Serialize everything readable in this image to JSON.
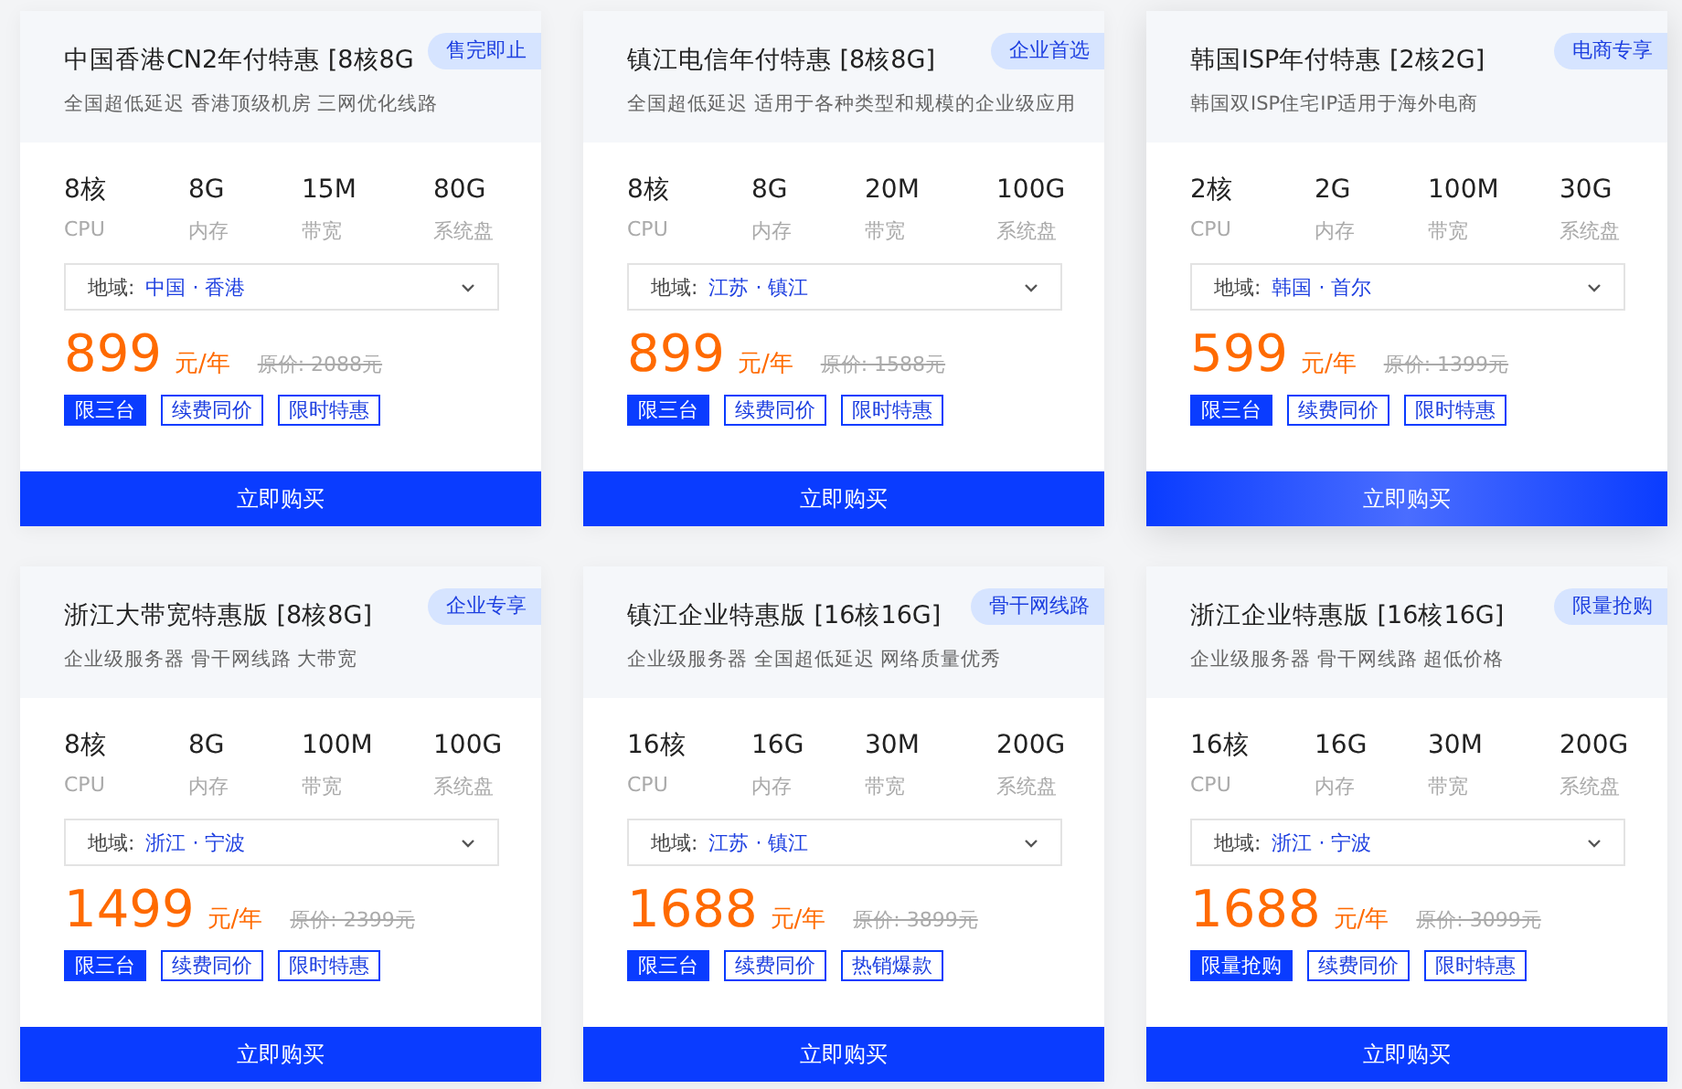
{
  "cards": [
    {
      "title": "中国香港CN2年付特惠 [8核8G",
      "badge": "售完即止",
      "subtitle": "全国超低延迟 香港顶级机房 三网优化线路",
      "specs": [
        {
          "value": "8核",
          "label": "CPU"
        },
        {
          "value": "8G",
          "label": "内存"
        },
        {
          "value": "15M",
          "label": "带宽"
        },
        {
          "value": "80G",
          "label": "系统盘"
        }
      ],
      "region_label": "地域:",
      "region": "中国 · 香港",
      "price": "899",
      "unit": "元/年",
      "original_price": "原价: 2088元",
      "tags": [
        {
          "text": "限三台",
          "filled": true
        },
        {
          "text": "续费同价",
          "filled": false
        },
        {
          "text": "限时特惠",
          "filled": false
        }
      ],
      "button": "立即购买",
      "hovered": false
    },
    {
      "title": "镇江电信年付特惠 [8核8G]",
      "badge": "企业首选",
      "subtitle": "全国超低延迟 适用于各种类型和规模的企业级应用",
      "specs": [
        {
          "value": "8核",
          "label": "CPU"
        },
        {
          "value": "8G",
          "label": "内存"
        },
        {
          "value": "20M",
          "label": "带宽"
        },
        {
          "value": "100G",
          "label": "系统盘"
        }
      ],
      "region_label": "地域:",
      "region": "江苏 · 镇江",
      "price": "899",
      "unit": "元/年",
      "original_price": "原价: 1588元",
      "tags": [
        {
          "text": "限三台",
          "filled": true
        },
        {
          "text": "续费同价",
          "filled": false
        },
        {
          "text": "限时特惠",
          "filled": false
        }
      ],
      "button": "立即购买",
      "hovered": false
    },
    {
      "title": "韩国ISP年付特惠 [2核2G]",
      "badge": "电商专享",
      "subtitle": "韩国双ISP住宅IP适用于海外电商",
      "specs": [
        {
          "value": "2核",
          "label": "CPU"
        },
        {
          "value": "2G",
          "label": "内存"
        },
        {
          "value": "100M",
          "label": "带宽"
        },
        {
          "value": "30G",
          "label": "系统盘"
        }
      ],
      "region_label": "地域:",
      "region": "韩国 · 首尔",
      "price": "599",
      "unit": "元/年",
      "original_price": "原价: 1399元",
      "tags": [
        {
          "text": "限三台",
          "filled": true
        },
        {
          "text": "续费同价",
          "filled": false
        },
        {
          "text": "限时特惠",
          "filled": false
        }
      ],
      "button": "立即购买",
      "hovered": true
    },
    {
      "title": "浙江大带宽特惠版 [8核8G]",
      "badge": "企业专享",
      "subtitle": "企业级服务器 骨干网线路 大带宽",
      "specs": [
        {
          "value": "8核",
          "label": "CPU"
        },
        {
          "value": "8G",
          "label": "内存"
        },
        {
          "value": "100M",
          "label": "带宽"
        },
        {
          "value": "100G",
          "label": "系统盘"
        }
      ],
      "region_label": "地域:",
      "region": "浙江 · 宁波",
      "price": "1499",
      "unit": "元/年",
      "original_price": "原价: 2399元",
      "tags": [
        {
          "text": "限三台",
          "filled": true
        },
        {
          "text": "续费同价",
          "filled": false
        },
        {
          "text": "限时特惠",
          "filled": false
        }
      ],
      "button": "立即购买",
      "hovered": false
    },
    {
      "title": "镇江企业特惠版 [16核16G]",
      "badge": "骨干网线路",
      "subtitle": "企业级服务器 全国超低延迟 网络质量优秀",
      "specs": [
        {
          "value": "16核",
          "label": "CPU"
        },
        {
          "value": "16G",
          "label": "内存"
        },
        {
          "value": "30M",
          "label": "带宽"
        },
        {
          "value": "200G",
          "label": "系统盘"
        }
      ],
      "region_label": "地域:",
      "region": "江苏 · 镇江",
      "price": "1688",
      "unit": "元/年",
      "original_price": "原价: 3899元",
      "tags": [
        {
          "text": "限三台",
          "filled": true
        },
        {
          "text": "续费同价",
          "filled": false
        },
        {
          "text": "热销爆款",
          "filled": false
        }
      ],
      "button": "立即购买",
      "hovered": false
    },
    {
      "title": "浙江企业特惠版 [16核16G]",
      "badge": "限量抢购",
      "subtitle": "企业级服务器 骨干网线路 超低价格",
      "specs": [
        {
          "value": "16核",
          "label": "CPU"
        },
        {
          "value": "16G",
          "label": "内存"
        },
        {
          "value": "30M",
          "label": "带宽"
        },
        {
          "value": "200G",
          "label": "系统盘"
        }
      ],
      "region_label": "地域:",
      "region": "浙江 · 宁波",
      "price": "1688",
      "unit": "元/年",
      "original_price": "原价: 3099元",
      "tags": [
        {
          "text": "限量抢购",
          "filled": true
        },
        {
          "text": "续费同价",
          "filled": false
        },
        {
          "text": "限时特惠",
          "filled": false
        }
      ],
      "button": "立即购买",
      "hovered": false
    }
  ]
}
